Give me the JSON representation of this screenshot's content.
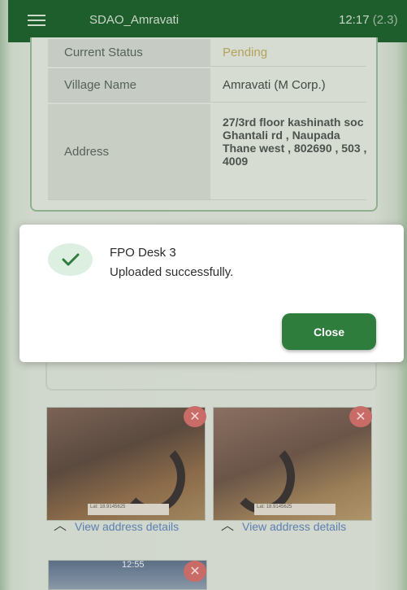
{
  "topbar": {
    "title": "SDAO_Amravati",
    "time": "12:17",
    "version": "(2.3)"
  },
  "details": {
    "rows": [
      {
        "label": "Current Status",
        "value": "Pending"
      },
      {
        "label": "Village Name",
        "value": "Amravati (M Corp.)"
      },
      {
        "label": "Address",
        "value": "27/3rd floor kashinath soc Ghantali rd , Naupada Thane west , 802690 , 503 , 4009"
      }
    ]
  },
  "photos": [
    {
      "stamp": "Lat: 18.9145625",
      "link_label": "View address details"
    },
    {
      "stamp": "Lat: 18.9145625",
      "link_label": "View address details"
    },
    {
      "stamp": "12:55"
    }
  ],
  "dialog": {
    "title": "FPO Desk 3",
    "message": "Uploaded successfully.",
    "close_label": "Close"
  },
  "colors": {
    "appbar": "#1e5e2d",
    "primary_button": "#2f7d3d",
    "status_pending": "#b4a25b",
    "link": "#5d7fb0",
    "delete_badge": "#c96b66"
  },
  "icons": {
    "menu": "hamburger-icon",
    "success": "check-icon",
    "delete": "close-icon",
    "expand": "chevron-up-icon"
  }
}
